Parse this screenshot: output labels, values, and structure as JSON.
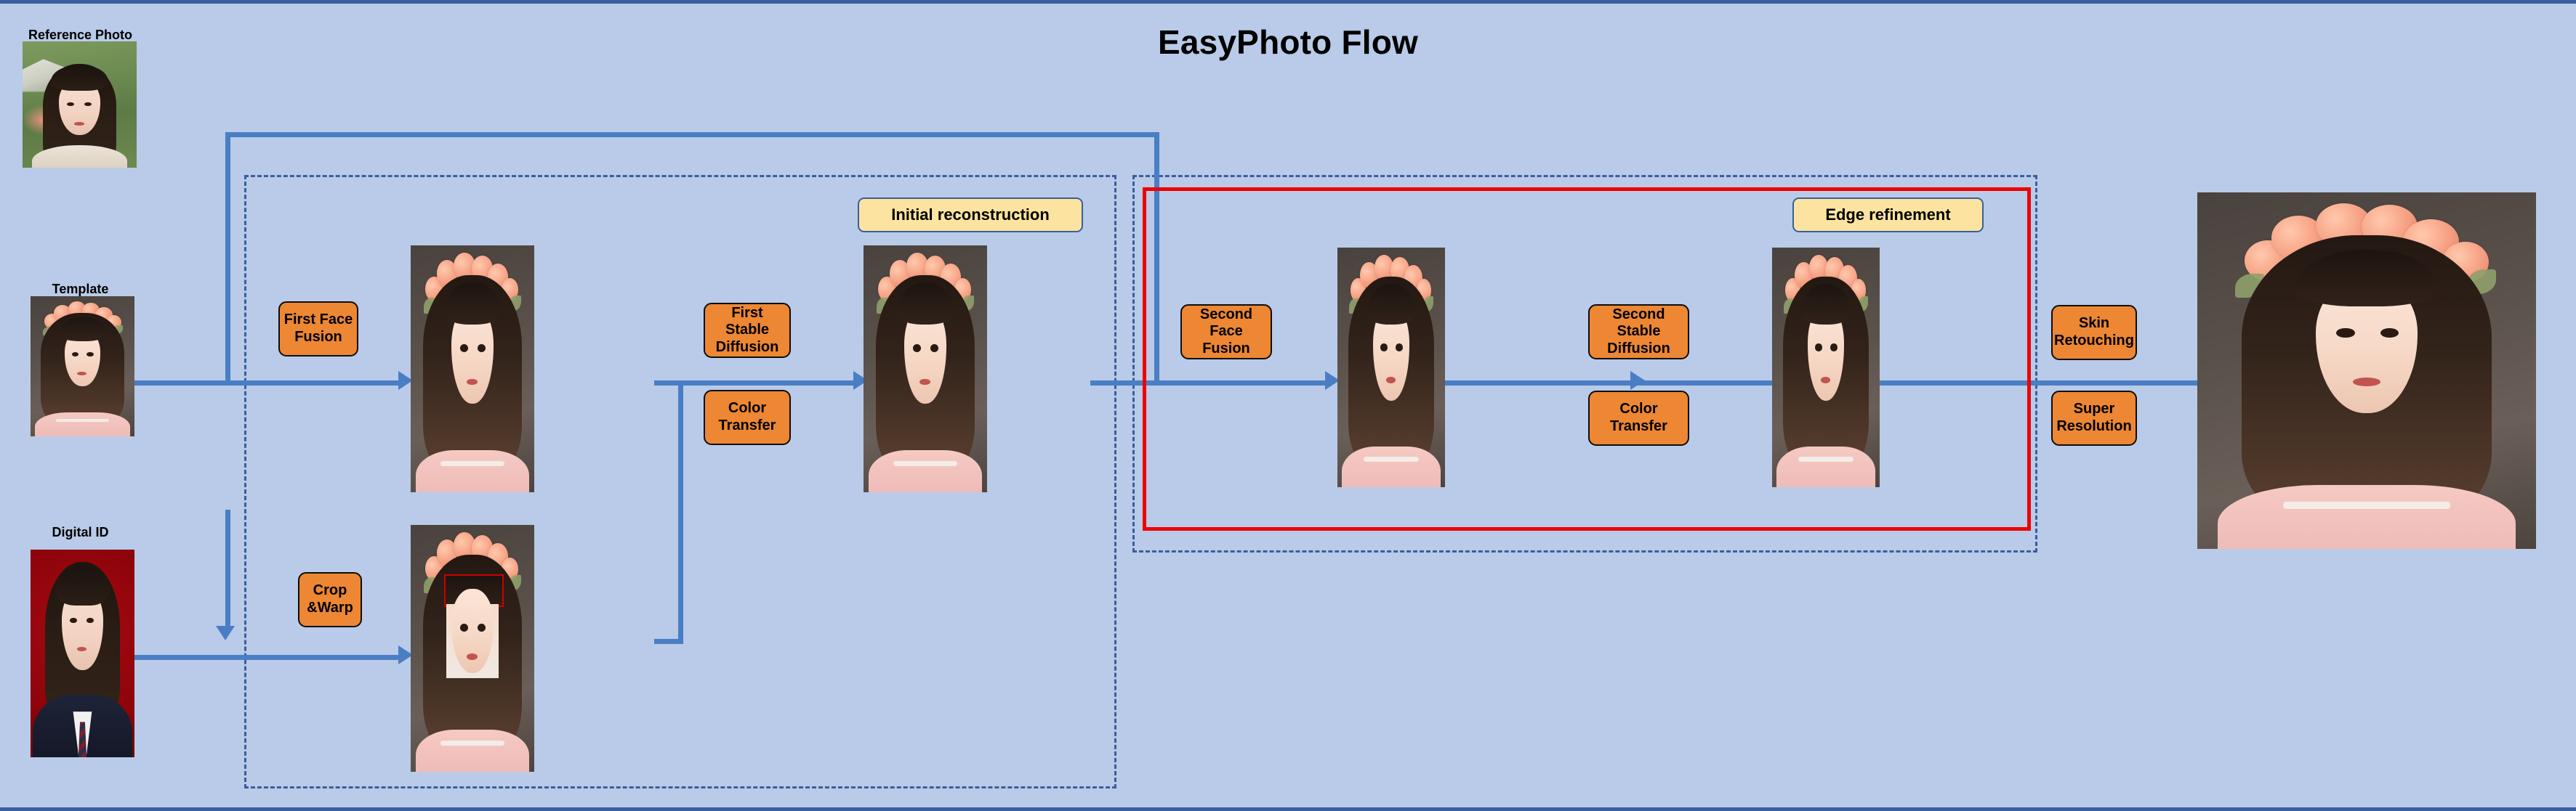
{
  "diagram": {
    "title": "EasyPhoto Flow",
    "background_color": "#b9cbe8",
    "accent_color": "#4a7ec4",
    "process_color": "#ed8733",
    "stage_color": "#fce4a0",
    "highlight_color": "#ef0000"
  },
  "inputs": [
    {
      "id": "reference-photo",
      "label": "Reference Photo",
      "description": "portrait of a woman with long dark hair, outdoor green foliage background"
    },
    {
      "id": "template",
      "label": "Template",
      "description": "woman wearing a peach flower crown, blurred warm background"
    },
    {
      "id": "digital-id",
      "label": "Digital ID",
      "description": "ID photo on red background, dark suit, white shirt, striped tie"
    }
  ],
  "processes": [
    {
      "id": "first-face-fusion",
      "label": "First Face\nFusion"
    },
    {
      "id": "crop-and-warp",
      "label": "Crop\n&Warp"
    },
    {
      "id": "first-stable-diffusion",
      "label": "First Stable\nDiffusion"
    },
    {
      "id": "color-transfer-1",
      "label": "Color\nTransfer"
    },
    {
      "id": "second-face-fusion",
      "label": "Second\nFace Fusion"
    },
    {
      "id": "second-stable-diffusion",
      "label": "Second Stable\nDiffusion"
    },
    {
      "id": "color-transfer-2",
      "label": "Color\nTransfer"
    },
    {
      "id": "skin-retouching",
      "label": "Skin\nRetouching"
    },
    {
      "id": "super-resolution",
      "label": "Super\nResolution"
    }
  ],
  "stages": [
    {
      "id": "initial-reconstruction",
      "label": "Initial reconstruction"
    },
    {
      "id": "edge-refinement",
      "label": "Edge refinement"
    }
  ],
  "intermediate_images": [
    {
      "id": "fused-face-result",
      "description": "flower-crown portrait after first face fusion"
    },
    {
      "id": "warped-face-result",
      "description": "flower-crown portrait with cropped and warped ID face pasted in, red crop rectangle visible"
    },
    {
      "id": "initial-result",
      "description": "flower-crown portrait after first stable diffusion and color transfer"
    },
    {
      "id": "second-fusion-result",
      "description": "flower-crown portrait after second face fusion"
    },
    {
      "id": "refined-result",
      "description": "flower-crown portrait after second stable diffusion and color transfer"
    },
    {
      "id": "final-output",
      "description": "high-resolution final flower-crown portrait"
    }
  ]
}
